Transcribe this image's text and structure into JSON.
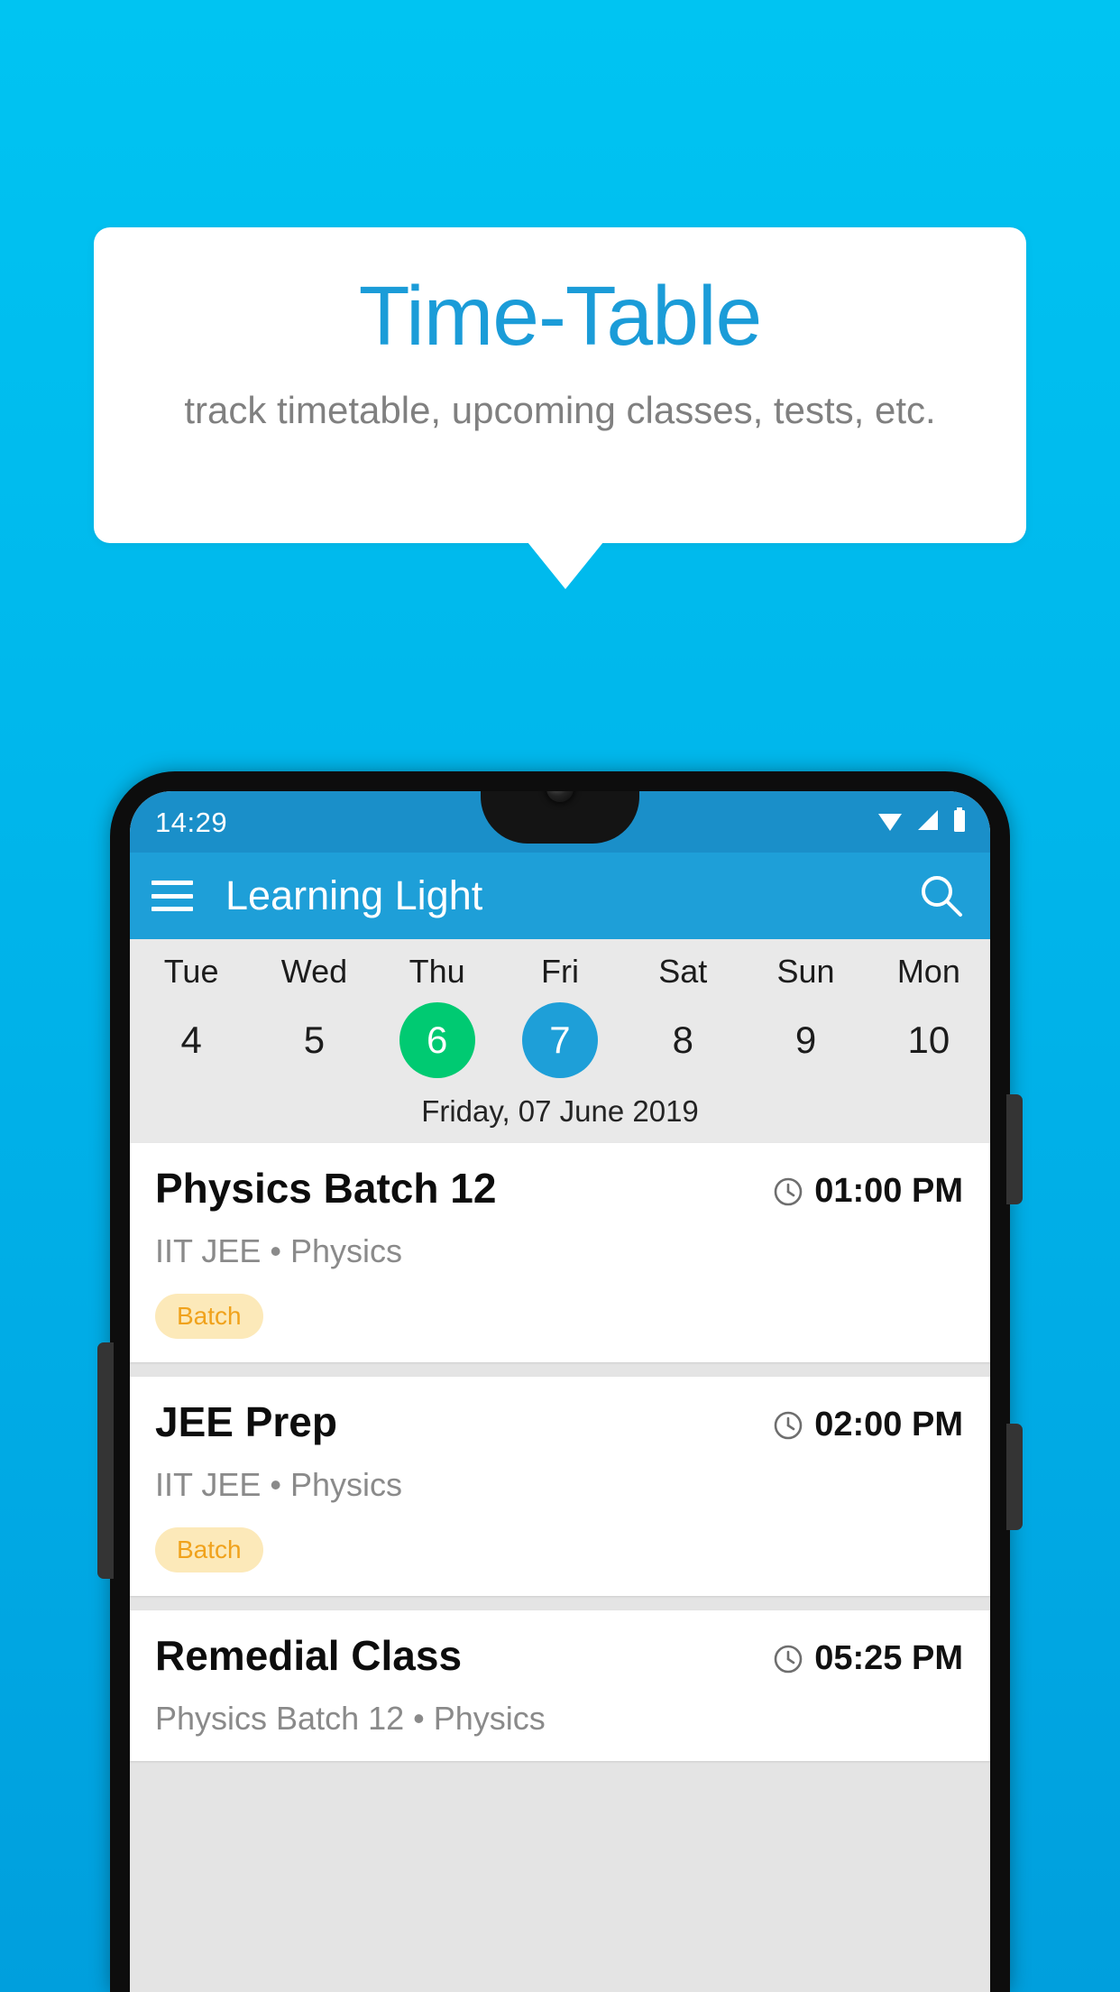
{
  "promo": {
    "title": "Time-Table",
    "subtitle": "track timetable, upcoming classes, tests, etc.",
    "title_color": "#1b9cd8",
    "background_color": "#00b8ec"
  },
  "phone": {
    "statusbar": {
      "time": "14:29",
      "icons": [
        "wifi-icon",
        "signal-icon",
        "battery-icon"
      ]
    },
    "appbar": {
      "menu_icon": "hamburger-menu-icon",
      "title": "Learning Light",
      "search_icon": "search-icon",
      "color": "#1e9fd8"
    },
    "datestrip": {
      "days": [
        {
          "dow": "Tue",
          "num": "4",
          "state": "normal"
        },
        {
          "dow": "Wed",
          "num": "5",
          "state": "normal"
        },
        {
          "dow": "Thu",
          "num": "6",
          "state": "today"
        },
        {
          "dow": "Fri",
          "num": "7",
          "state": "selected"
        },
        {
          "dow": "Sat",
          "num": "8",
          "state": "normal"
        },
        {
          "dow": "Sun",
          "num": "9",
          "state": "normal"
        },
        {
          "dow": "Mon",
          "num": "10",
          "state": "normal"
        }
      ],
      "today_color": "#00ca72",
      "selected_color": "#1e9fd8",
      "selected_date_label": "Friday, 07 June 2019"
    },
    "classes": [
      {
        "title": "Physics Batch 12",
        "time": "01:00 PM",
        "subtitle": "IIT JEE • Physics",
        "badge": "Batch",
        "clock_icon": "clock-icon"
      },
      {
        "title": "JEE Prep",
        "time": "02:00 PM",
        "subtitle": "IIT JEE • Physics",
        "badge": "Batch",
        "clock_icon": "clock-icon"
      },
      {
        "title": "Remedial Class",
        "time": "05:25 PM",
        "subtitle": "Physics Batch 12 • Physics",
        "badge": "",
        "clock_icon": "clock-icon"
      }
    ]
  }
}
